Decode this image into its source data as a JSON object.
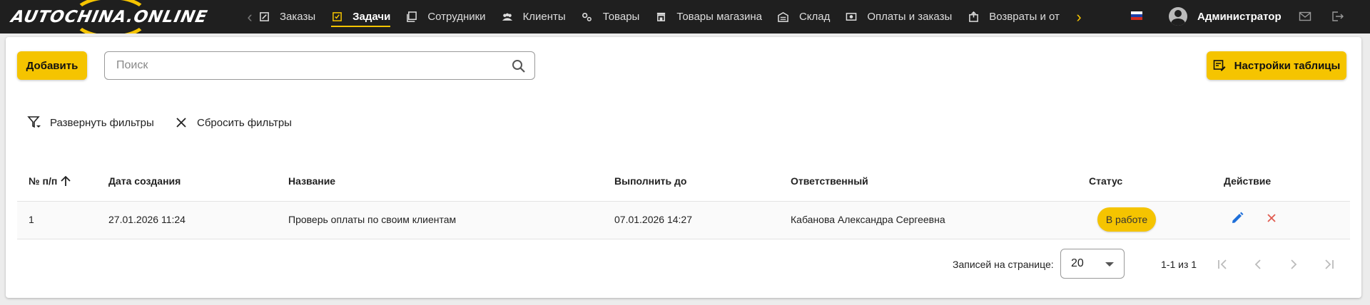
{
  "header": {
    "logo_text": "AUTOCHINA.ONLINE",
    "nav_items": [
      {
        "label": "Заказы",
        "icon": "orders-icon",
        "active": false
      },
      {
        "label": "Задачи",
        "icon": "tasks-icon",
        "active": true
      },
      {
        "label": "Сотрудники",
        "icon": "employees-icon",
        "active": false
      },
      {
        "label": "Клиенты",
        "icon": "clients-icon",
        "active": false
      },
      {
        "label": "Товары",
        "icon": "products-icon",
        "active": false
      },
      {
        "label": "Товары магазина",
        "icon": "store-products-icon",
        "active": false
      },
      {
        "label": "Склад",
        "icon": "warehouse-icon",
        "active": false
      },
      {
        "label": "Оплаты и заказы",
        "icon": "payments-icon",
        "active": false
      },
      {
        "label": "Возвраты и от",
        "icon": "returns-icon",
        "active": false
      }
    ],
    "user_name": "Администратор",
    "language": "RU",
    "colors": {
      "accent": "#f5c400",
      "bar": "#1f1f1f"
    }
  },
  "toolbar": {
    "add_label": "Добавить",
    "search_placeholder": "Поиск",
    "table_settings_label": "Настройки таблицы",
    "expand_filters_label": "Развернуть фильтры",
    "reset_filters_label": "Сбросить фильтры"
  },
  "table": {
    "columns": [
      "№ п/п",
      "Дата создания",
      "Название",
      "Выполнить до",
      "Ответственный",
      "Статус",
      "Действие"
    ],
    "sort": {
      "column": "№ п/п",
      "direction": "asc"
    },
    "rows": [
      {
        "num": "1",
        "created": "27.01.2026 11:24",
        "title": "Проверь оплаты по своим клиентам",
        "due": "07.01.2026 14:27",
        "assignee": "Кабанова Александра Сергеевна",
        "status": "В работе"
      }
    ]
  },
  "pagination": {
    "rows_per_page_label": "Записей на странице:",
    "rows_per_page": "20",
    "range": "1-1 из 1"
  }
}
